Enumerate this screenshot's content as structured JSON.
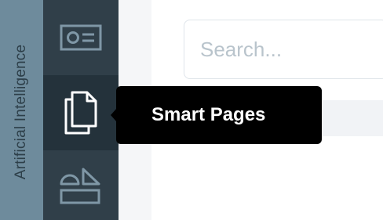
{
  "sidebar": {
    "section_label": "Artificial Intelligence",
    "items": [
      {
        "name": "id-card-icon",
        "active": false
      },
      {
        "name": "pages-icon",
        "active": true
      },
      {
        "name": "shapes-icon",
        "active": false
      }
    ]
  },
  "tooltip": {
    "text": "Smart Pages"
  },
  "search": {
    "placeholder": "Search..."
  },
  "colors": {
    "label_strip": "#6e8b9c",
    "icon_column": "#303f49",
    "icon_active_bg": "#24323b",
    "icon_stroke": "#7f97a6",
    "icon_active_stroke": "#ffffff",
    "tooltip_bg": "#000000"
  }
}
